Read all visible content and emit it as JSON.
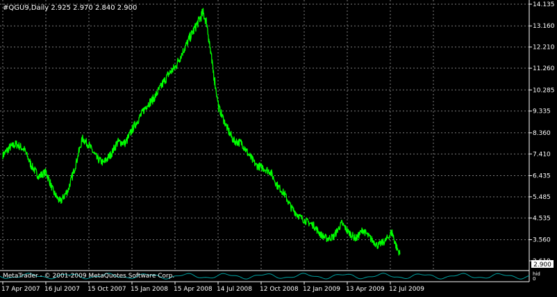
{
  "chart_data": {
    "type": "line",
    "symbol_header": "#QGU9,Daily  2.925 2.970 2.840 2.900",
    "copyright": "MetaTrader - © 2001-2009 MetaQuotes Software Corp.",
    "current_price": "2.900",
    "ylim": [
      2.61,
      14.135
    ],
    "grid": true,
    "y_ticks": [
      "14.135",
      "13.160",
      "12.210",
      "11.260",
      "10.285",
      "9.335",
      "8.360",
      "7.410",
      "6.435",
      "5.485",
      "4.535",
      "3.560",
      "2.610"
    ],
    "x_ticks": [
      "17 Apr 2007",
      "16 Jul 2007",
      "15 Oct 2007",
      "15 Jan 2008",
      "15 Apr 2008",
      "14 Jul 2008",
      "12 Oct 2008",
      "12 Jan 2009",
      "13 Apr 2009",
      "12 Jul 2009"
    ],
    "sub_ticks": [
      "hid",
      "0"
    ],
    "series": [
      {
        "points": [
          [
            "17 Apr 2007",
            7.35
          ],
          [
            "01 May 2007",
            7.7
          ],
          [
            "15 May 2007",
            7.85
          ],
          [
            "01 Jun 2007",
            7.6
          ],
          [
            "15 Jun 2007",
            6.9
          ],
          [
            "01 Jul 2007",
            6.4
          ],
          [
            "16 Jul 2007",
            6.6
          ],
          [
            "01 Aug 2007",
            5.7
          ],
          [
            "15 Aug 2007",
            5.25
          ],
          [
            "01 Sep 2007",
            5.8
          ],
          [
            "15 Sep 2007",
            6.8
          ],
          [
            "01 Oct 2007",
            8.1
          ],
          [
            "15 Oct 2007",
            7.8
          ],
          [
            "01 Nov 2007",
            7.2
          ],
          [
            "15 Nov 2007",
            7.0
          ],
          [
            "01 Dec 2007",
            7.4
          ],
          [
            "15 Dec 2007",
            7.95
          ],
          [
            "01 Jan 2008",
            7.9
          ],
          [
            "15 Jan 2008",
            8.5
          ],
          [
            "01 Feb 2008",
            9.1
          ],
          [
            "15 Feb 2008",
            9.6
          ],
          [
            "01 Mar 2008",
            9.9
          ],
          [
            "15 Mar 2008",
            10.4
          ],
          [
            "01 Apr 2008",
            11.0
          ],
          [
            "15 Apr 2008",
            11.3
          ],
          [
            "01 May 2008",
            12.0
          ],
          [
            "15 May 2008",
            12.6
          ],
          [
            "01 Jun 2008",
            13.3
          ],
          [
            "12 Jun 2008",
            13.75
          ],
          [
            "20 Jun 2008",
            13.3
          ],
          [
            "01 Jul 2008",
            11.5
          ],
          [
            "15 Jul 2008",
            9.5
          ],
          [
            "01 Aug 2008",
            8.6
          ],
          [
            "15 Aug 2008",
            8.0
          ],
          [
            "01 Sep 2008",
            7.9
          ],
          [
            "15 Sep 2008",
            7.4
          ],
          [
            "01 Oct 2008",
            6.9
          ],
          [
            "15 Oct 2008",
            6.8
          ],
          [
            "01 Nov 2008",
            6.6
          ],
          [
            "15 Nov 2008",
            6.0
          ],
          [
            "01 Dec 2008",
            5.6
          ],
          [
            "15 Dec 2008",
            5.0
          ],
          [
            "01 Jan 2009",
            4.6
          ],
          [
            "15 Jan 2009",
            4.4
          ],
          [
            "01 Feb 2009",
            4.2
          ],
          [
            "15 Feb 2009",
            3.8
          ],
          [
            "01 Mar 2009",
            3.6
          ],
          [
            "15 Mar 2009",
            3.7
          ],
          [
            "01 Apr 2009",
            4.3
          ],
          [
            "15 Apr 2009",
            3.9
          ],
          [
            "01 May 2009",
            3.6
          ],
          [
            "15 May 2009",
            4.0
          ],
          [
            "01 Jun 2009",
            3.6
          ],
          [
            "15 Jun 2009",
            3.3
          ],
          [
            "01 Jul 2009",
            3.5
          ],
          [
            "15 Jul 2009",
            3.9
          ],
          [
            "25 Jul 2009",
            3.2
          ],
          [
            "01 Aug 2009",
            2.9
          ]
        ]
      }
    ]
  }
}
